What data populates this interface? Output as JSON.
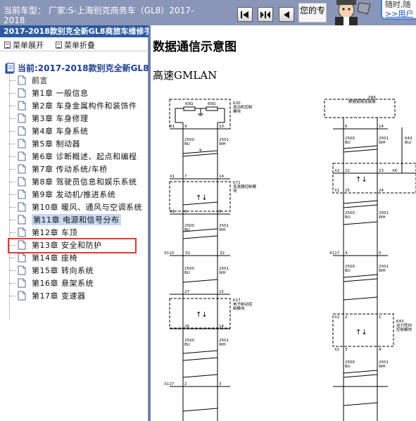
{
  "header": {
    "car_label": "当前车型： 厂家:S-上海别克商务车（GL8）2017-",
    "car_label_cont": "2018",
    "your_text": "您的专",
    "help_line1": "随时,随",
    "help_line2": ">>用户"
  },
  "nav": {
    "buttons": [
      "first-page",
      "split-view",
      "previous-page"
    ]
  },
  "sidebar": {
    "title": "2017-2018款别克全新GL8商旅车维修手",
    "expand_label": "菜单展开",
    "collapse_label": "菜单折叠",
    "root_label": "当前:2017-2018款别克全新GL8",
    "items": [
      {
        "label": "前言"
      },
      {
        "label": "第1章 一般信息"
      },
      {
        "label": "第2章 车身金属构件和装饰件"
      },
      {
        "label": "第3章 车身修理"
      },
      {
        "label": "第4章 车身系统"
      },
      {
        "label": "第5章 制动器"
      },
      {
        "label": "第6章 诊断概述、起点和编程"
      },
      {
        "label": "第7章 传动系统/车桥"
      },
      {
        "label": "第8章 驾驶员信息和娱乐系统"
      },
      {
        "label": "第9章 发动机/推进系统"
      },
      {
        "label": "第10章 暖风、通风与空调系统"
      },
      {
        "label": "第11章 电源和信号分布",
        "selected": true
      },
      {
        "label": "第12章 车顶"
      },
      {
        "label": "第13章 安全和防护"
      },
      {
        "label": "第14章 座椅"
      },
      {
        "label": "第15章 转向系统"
      },
      {
        "label": "第16章 悬架系统"
      },
      {
        "label": "第17章 变速器"
      }
    ]
  },
  "main": {
    "title": "数据通信示意图",
    "subtitle": "高速GMLAN"
  },
  "diagram": {
    "k20_id": "K20",
    "k20_name1": "发动机控制",
    "k20_name2": "模块",
    "res1": "60Ω",
    "res2": "60Ω",
    "x84_id": "X84",
    "x84_name": "数据链路连接器",
    "k71_id": "K71",
    "k71_name1": "变速器控制模",
    "k71_name2": "块",
    "k17_id": "K17",
    "k17_name1": "电子制动控",
    "k17_name2": "制模块",
    "k43_id": "K43",
    "k43_name1": "动力转向",
    "k43_name2": "控制模块",
    "conn_x1": "X1",
    "conn_x2": "X2",
    "conn_x6": "X6",
    "conn_x110": "X110",
    "conn_x117": "X117",
    "pin_9": "9",
    "pin_10": "10",
    "pin_7": "7",
    "pin_14": "14",
    "pin_6": "6",
    "pin_8": "8",
    "pin_31": "31",
    "pin_32": "32",
    "pin_27": "27",
    "pin_15": "15",
    "pin_26": "26",
    "pin_4": "4",
    "pin_5": "5",
    "pin_2": "2",
    "pin_3": "3",
    "pin_22": "22",
    "pin_23": "23",
    "pin_25": "25",
    "pin_24": "24",
    "pin_1": "1",
    "wire_2500": "2500",
    "wire_2501": "2501",
    "color_bu": "BU",
    "color_wh": "WH",
    "twist": "9",
    "wire_643": "643",
    "color_bu_a": "BU/",
    "colors": {
      "frame": "#6b7fa8",
      "title_bar": "#2c5aa0",
      "highlight": "#e53935",
      "top_bar": "#8a96b8"
    }
  }
}
